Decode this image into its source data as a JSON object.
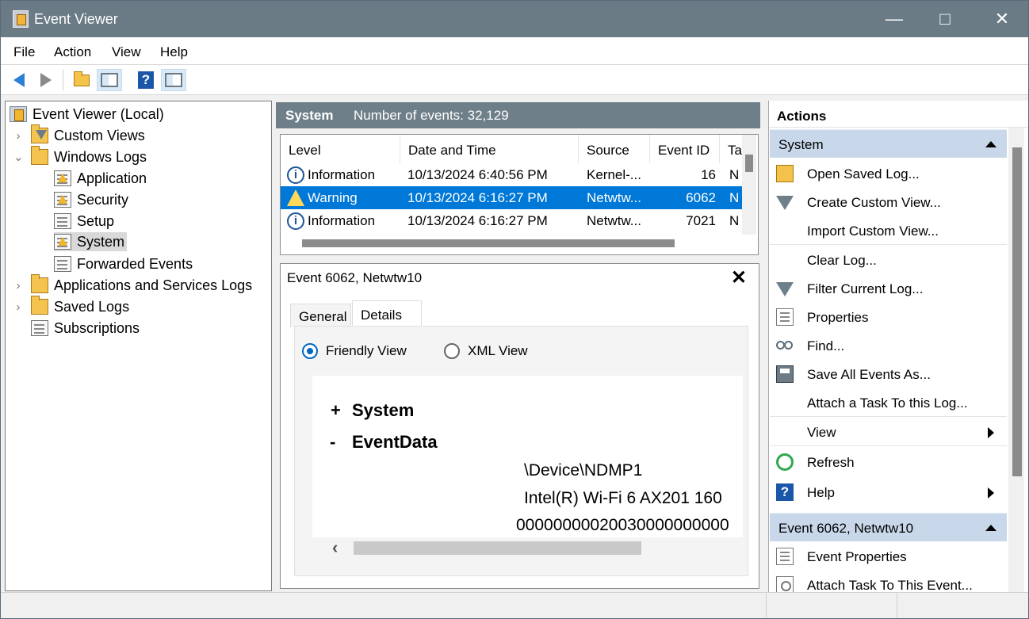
{
  "window": {
    "title": "Event Viewer",
    "controls": {
      "minimize": "—",
      "maximize": "□",
      "close": "✕"
    }
  },
  "menu": [
    "File",
    "Action",
    "View",
    "Help"
  ],
  "toolbar": [
    "back-icon",
    "forward-icon",
    "up-folder-icon",
    "show-hide-tree-icon",
    "help-icon",
    "show-hide-action-pane-icon"
  ],
  "tree": {
    "items": [
      {
        "label": "Event Viewer (Local)",
        "icon": "event-viewer-icon"
      },
      {
        "label": "Custom Views",
        "icon": "folder-filter-icon",
        "expander": "›"
      },
      {
        "label": "Windows Logs",
        "icon": "folder-icon",
        "expander": "⌄"
      },
      {
        "label": "Application",
        "icon": "log-warning-icon"
      },
      {
        "label": "Security",
        "icon": "log-warning-icon"
      },
      {
        "label": "Setup",
        "icon": "log-icon"
      },
      {
        "label": "System",
        "icon": "log-warning-icon"
      },
      {
        "label": "Forwarded Events",
        "icon": "log-icon"
      },
      {
        "label": "Applications and Services Logs",
        "icon": "folder-icon",
        "expander": "›"
      },
      {
        "label": "Saved Logs",
        "icon": "folder-icon",
        "expander": "›"
      },
      {
        "label": "Subscriptions",
        "icon": "subscription-icon"
      }
    ]
  },
  "log": {
    "name": "System",
    "count_text": "Number of events: 32,129"
  },
  "events": {
    "columns": [
      "Level",
      "Date and Time",
      "Source",
      "Event ID",
      "Ta"
    ],
    "rows": [
      {
        "level": "Information",
        "date": "10/13/2024 6:40:56 PM",
        "source": "Kernel-...",
        "event_id": "16",
        "task": "N"
      },
      {
        "level": "Warning",
        "date": "10/13/2024 6:16:27 PM",
        "source": "Netwtw...",
        "event_id": "6062",
        "task": "N"
      },
      {
        "level": "Information",
        "date": "10/13/2024 6:16:27 PM",
        "source": "Netwtw...",
        "event_id": "7021",
        "task": "N"
      }
    ]
  },
  "detail": {
    "title": "Event 6062, Netwtw10",
    "close": "✕",
    "tabs": [
      "General",
      "Details"
    ],
    "views": {
      "friendly": "Friendly View",
      "xml": "XML View"
    },
    "xml": {
      "system_sign": "+",
      "system_label": "System",
      "eventdata_sign": "-",
      "eventdata_label": "EventData",
      "values": [
        "\\Device\\NDMP1",
        "Intel(R) Wi-Fi 6 AX201 160",
        "00000000020030000000000"
      ]
    },
    "scroll_left": "‹"
  },
  "actions": {
    "title": "Actions",
    "section_system": "System",
    "system_items": [
      {
        "label": "Open Saved Log...",
        "icon": "open-folder-icon"
      },
      {
        "label": "Create Custom View...",
        "icon": "filter-icon"
      },
      {
        "label": "Import Custom View...",
        "icon": ""
      },
      {
        "label": "Clear Log...",
        "icon": ""
      },
      {
        "label": "Filter Current Log...",
        "icon": "filter-icon"
      },
      {
        "label": "Properties",
        "icon": "properties-icon"
      },
      {
        "label": "Find...",
        "icon": "find-icon"
      },
      {
        "label": "Save All Events As...",
        "icon": "save-icon"
      },
      {
        "label": "Attach a Task To this Log...",
        "icon": ""
      },
      {
        "label": "View",
        "icon": ""
      },
      {
        "label": "Refresh",
        "icon": "refresh-icon"
      },
      {
        "label": "Help",
        "icon": "help-icon"
      }
    ],
    "section_event": "Event 6062, Netwtw10",
    "event_items": [
      {
        "label": "Event Properties",
        "icon": "properties-icon"
      },
      {
        "label": "Attach Task To This Event...",
        "icon": "task-icon"
      }
    ]
  }
}
